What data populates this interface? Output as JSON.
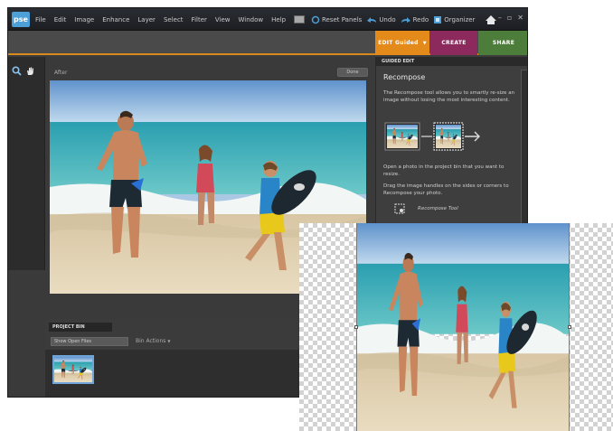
{
  "app": {
    "logo": "pse",
    "menu": [
      "File",
      "Edit",
      "Image",
      "Enhance",
      "Layer",
      "Select",
      "Filter",
      "View",
      "Window",
      "Help"
    ],
    "toolbar": {
      "reset_panels": "Reset Panels",
      "undo": "Undo",
      "redo": "Redo",
      "organizer": "Organizer"
    },
    "tabs": {
      "edit_guided": "EDIT Guided",
      "create": "CREATE",
      "share": "SHARE"
    }
  },
  "canvas": {
    "view_label": "After",
    "done_label": "Done"
  },
  "project_bin": {
    "title": "PROJECT BIN",
    "select_value": "Show Open Files",
    "actions_label": "Bin Actions"
  },
  "guided_panel": {
    "header": "GUIDED EDIT",
    "title": "Recompose",
    "description": "The Recompose tool allows you to smartly re-size an image without losing the most interesting content.",
    "step1": "Open a photo in the project bin that you want to resize.",
    "step2": "Drag the image handles on the sides or corners to Recompose your photo.",
    "tool_label": "Recompose Tool"
  },
  "colors": {
    "accent_orange": "#e38a1b",
    "create_purple": "#8c2a5e",
    "share_green": "#4d7d3a",
    "highlight_blue": "#4d9fd8"
  }
}
